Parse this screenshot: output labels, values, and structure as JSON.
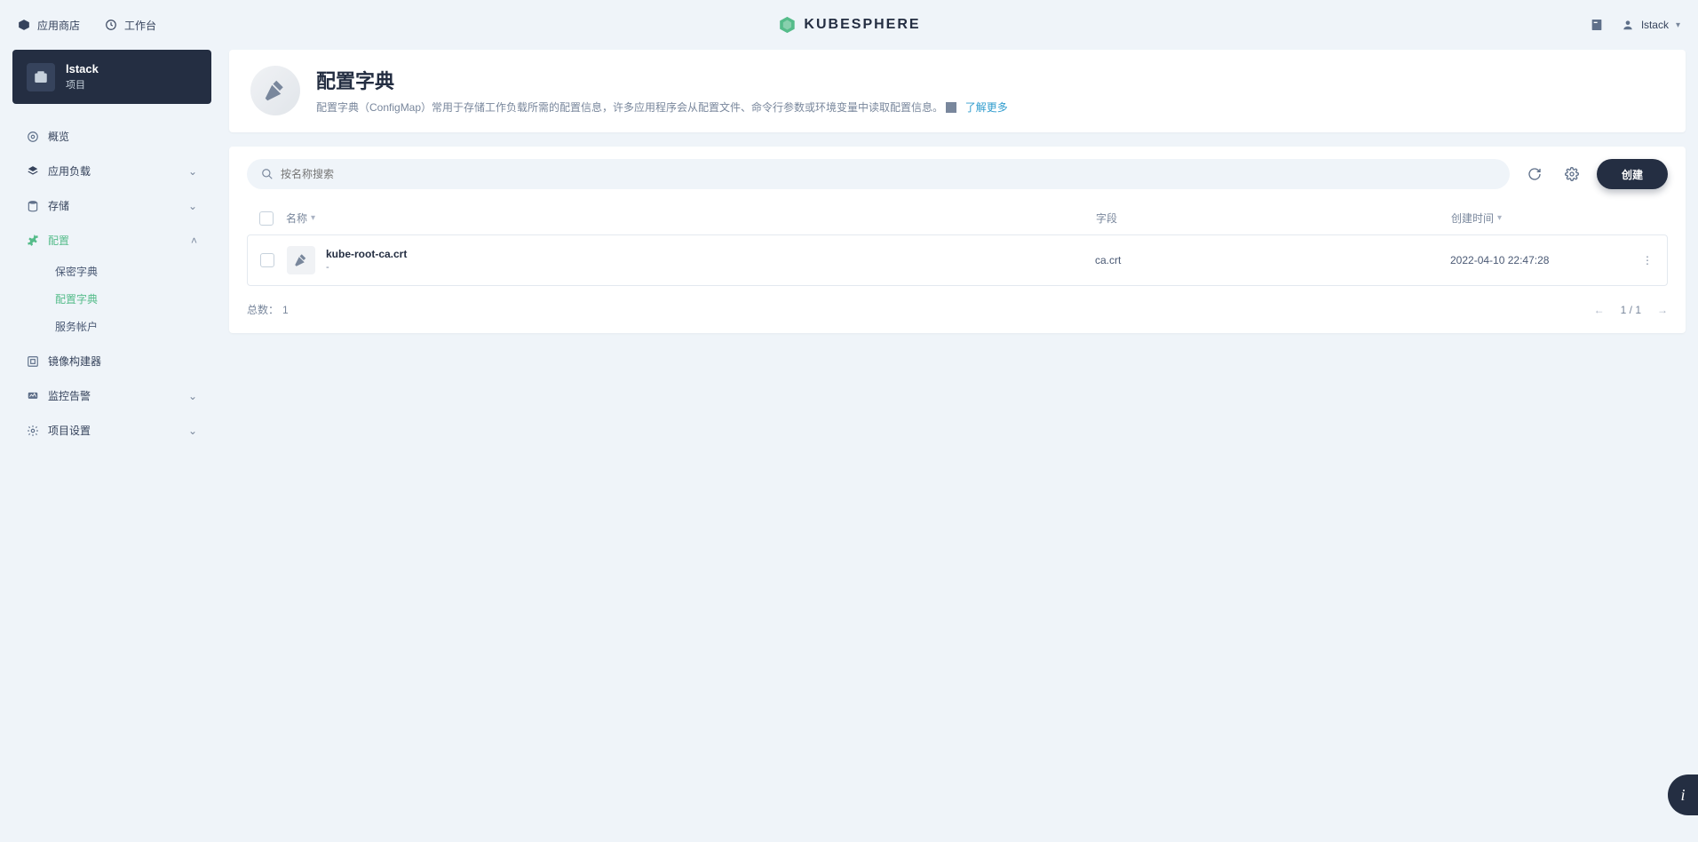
{
  "header": {
    "app_store": "应用商店",
    "workbench": "工作台",
    "brand": "KUBESPHERE",
    "user": "lstack"
  },
  "project": {
    "name": "lstack",
    "type": "项目"
  },
  "nav": {
    "overview": "概览",
    "workloads": "应用负载",
    "storage": "存储",
    "config": "配置",
    "config_subs": {
      "secrets": "保密字典",
      "configmaps": "配置字典",
      "service_accounts": "服务帐户"
    },
    "image_builder": "镜像构建器",
    "monitor": "监控告警",
    "project_settings": "项目设置"
  },
  "page": {
    "title": "配置字典",
    "desc": "配置字典（ConfigMap）常用于存储工作负载所需的配置信息，许多应用程序会从配置文件、命令行参数或环境变量中读取配置信息。",
    "learn_more": "了解更多"
  },
  "toolbar": {
    "search_placeholder": "按名称搜索",
    "create": "创建"
  },
  "table": {
    "col_name": "名称",
    "col_field": "字段",
    "col_created": "创建时间",
    "rows": [
      {
        "name": "kube-root-ca.crt",
        "sub": "-",
        "field": "ca.crt",
        "created": "2022-04-10 22:47:28"
      }
    ]
  },
  "footer": {
    "total_label": "总数：",
    "total_value": "1",
    "page_info": "1 / 1"
  }
}
